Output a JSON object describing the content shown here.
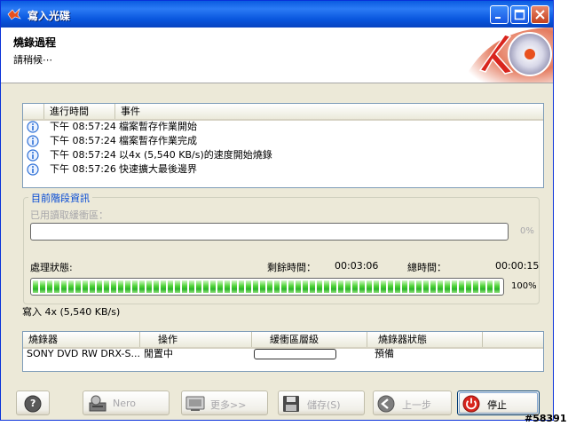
{
  "window": {
    "title": "寫入光碟"
  },
  "header": {
    "title": "燒錄過程",
    "subtitle": "請稍候⋯"
  },
  "events": {
    "columns": [
      "進行時間",
      "事件"
    ],
    "rows": [
      {
        "time": "下午 08:57:24",
        "event": "檔案暫存作業開始"
      },
      {
        "time": "下午 08:57:24",
        "event": "檔案暫存作業完成"
      },
      {
        "time": "下午 08:57:24",
        "event": "以4x (5,540 KB/s)的速度開始燒錄"
      },
      {
        "time": "下午 08:57:26",
        "event": "快速擴大最後邊界"
      }
    ]
  },
  "phase": {
    "group_title": "目前階段資訊",
    "buffer_label": "已用讀取緩衝區：",
    "buffer_percent": "0%",
    "buffer_fraction": 0,
    "status_label": "處理狀態:",
    "remaining_label": "剩餘時間：",
    "remaining_value": "00:03:06",
    "total_label": "總時間：",
    "total_value": "00:00:15",
    "progress_percent": "100%",
    "progress_fraction": 1.0,
    "speed_text": "寫入 4x (5,540 KB/s)"
  },
  "recorders": {
    "columns": [
      "燒錄器",
      "操作",
      "緩衝區層級",
      "燒錄器狀態"
    ],
    "rows": [
      {
        "recorder": "SONY DVD RW DRX-S...",
        "operation": "閒置中",
        "buffer_fraction": 0,
        "status": "預備"
      }
    ]
  },
  "buttons": {
    "help": "?",
    "nero": "Nero",
    "more": "更多>>",
    "save": "儲存(S)",
    "back": "上一步",
    "stop": "停止"
  },
  "watermark": "#58391",
  "colors": {
    "title_bar": "#0A5BE0",
    "progress_green": "#2CB52B",
    "group_title": "#0046D5",
    "stop_red": "#D9251D"
  }
}
